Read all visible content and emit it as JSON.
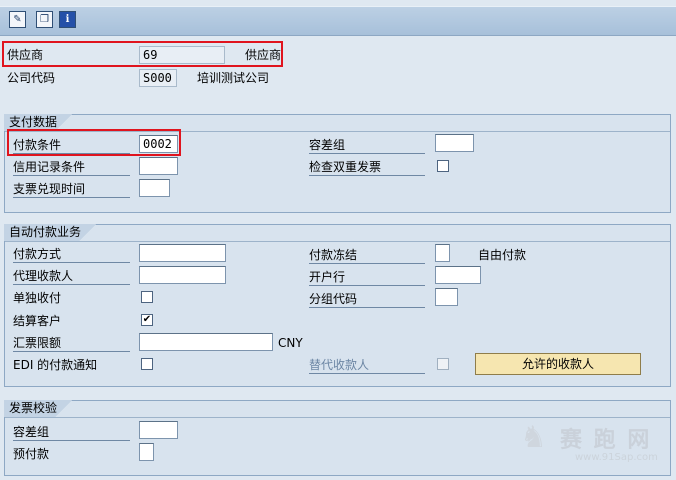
{
  "toolbar": {
    "icons": [
      "display-change-icon",
      "copy-icon",
      "info-icon"
    ],
    "info_glyph": "i"
  },
  "header": {
    "vendor_label": "供应商",
    "vendor_value": "69",
    "vendor_suffix": "供应商",
    "company_label": "公司代码",
    "company_value": "S000",
    "company_name": "培训测试公司"
  },
  "payment_data": {
    "title": "支付数据",
    "payment_terms_label": "付款条件",
    "payment_terms_value": "0002",
    "credit_memo_label": "信用记录条件",
    "credit_memo_value": "",
    "check_cashing_label": "支票兑现时间",
    "check_cashing_value": "",
    "tolerance_group_label": "容差组",
    "tolerance_group_value": "",
    "double_invoice_label": "检查双重发票",
    "double_invoice_checked": false
  },
  "auto_payment": {
    "title": "自动付款业务",
    "payment_methods_label": "付款方式",
    "payment_methods_value": "",
    "alt_payee_label": "代理收款人",
    "alt_payee_value": "",
    "individual_pmnt_label": "单独收付",
    "individual_pmnt_checked": false,
    "clearing_label": "结算客户",
    "clearing_checked": true,
    "bill_limit_label": "汇票限额",
    "bill_limit_value": "",
    "bill_limit_currency": "CNY",
    "edi_label": "EDI 的付款通知",
    "edi_checked": false,
    "payment_block_label": "付款冻结",
    "payment_block_value": "",
    "payment_block_text": "自由付款",
    "house_bank_label": "开户行",
    "house_bank_value": "",
    "grouping_key_label": "分组代码",
    "grouping_key_value": "",
    "alt_payee_doc_label": "替代收款人",
    "alt_payee_doc_checked": false,
    "permitted_payee_button": "允许的收款人"
  },
  "invoice_verification": {
    "title": "发票校验",
    "tolerance_group_label": "容差组",
    "tolerance_group_value": "",
    "prepayment_label": "预付款",
    "prepayment_value": ""
  },
  "watermark": {
    "text": "赛 跑 网",
    "url": "www.91Sap.com"
  },
  "colors": {
    "highlight": "#e0141e",
    "background": "#dfe8f1",
    "button": "#f6e6b0"
  }
}
